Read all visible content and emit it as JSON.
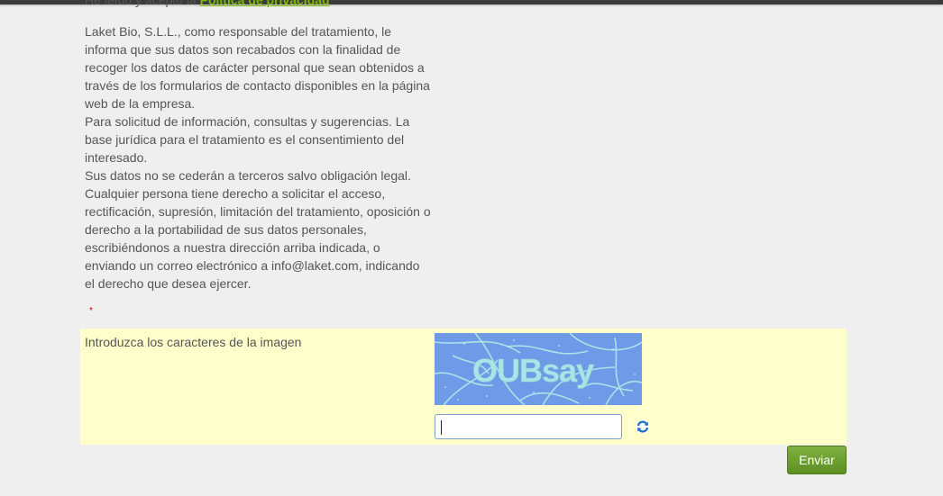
{
  "header": {
    "cut_text": "He leído y acepto la ",
    "cut_link": "Política de privacidad"
  },
  "privacy_notice": {
    "paragraphs": [
      "Laket Bio, S.L.L., como responsable del tratamiento, le informa que sus datos son recabados con la finalidad de recoger los datos de carácter personal que sean obtenidos a través de los formularios de contacto disponibles en la página web de la empresa.",
      "Para solicitud de información, consultas y sugerencias. La base jurídica para el tratamiento es el consentimiento del interesado.",
      "Sus datos no se cederán a terceros salvo obligación legal. Cualquier persona tiene derecho a solicitar el acceso, rectificación, supresión, limitación del tratamiento, oposición o derecho a la portabilidad de sus datos personales, escribiéndonos a nuestra dirección arriba indicada, o enviando un correo electrónico a info@laket.com, indicando el derecho que desea ejercer."
    ]
  },
  "required_marker": "*",
  "captcha": {
    "label": "Introduzca los caracteres de la imagen",
    "image_text": "OUBsay",
    "input_value": "",
    "refresh_icon": "refresh-icon"
  },
  "form": {
    "submit_label": "Enviar"
  },
  "colors": {
    "page_background": "#efefef",
    "captcha_panel": "#ffffcc",
    "captcha_image_bg": "#6f9ae8",
    "captcha_lines": "#a9e4e6",
    "button_green": "#6a9c2d",
    "link_green": "#7ab800",
    "required_red": "#d20000"
  }
}
